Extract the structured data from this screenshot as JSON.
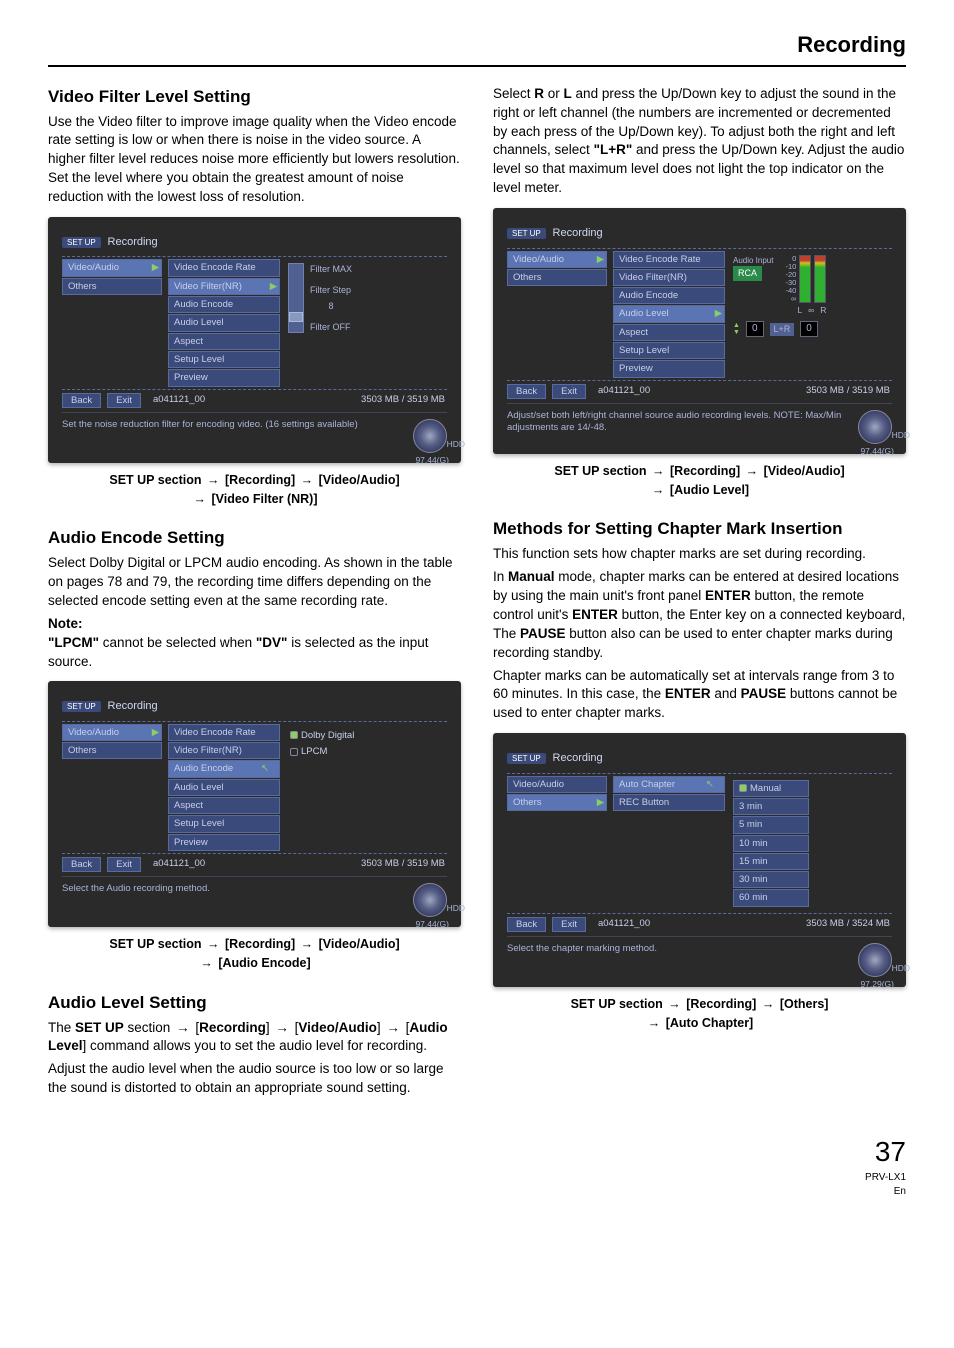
{
  "page_header": "Recording",
  "page_number": "37",
  "model": "PRV-LX1",
  "lang": "En",
  "arrow_glyph": "→",
  "left": {
    "video_filter": {
      "heading": "Video Filter Level Setting",
      "body": "Use the Video filter to improve image quality when the Video encode rate setting is low or when there is noise in the video source. A higher filter level reduces noise more efficiently but lowers resolution. Set the level where you obtain the greatest amount of noise reduction with the lowest loss of resolution.",
      "breadcrumb": [
        "SET UP section",
        "[Recording]",
        "[Video/Audio]",
        "[Video Filter (NR)]"
      ]
    },
    "audio_encode": {
      "heading": "Audio Encode Setting",
      "body": "Select Dolby Digital or LPCM audio encoding. As shown in the table on pages 78 and 79, the recording time differs depending on the selected encode setting even at the same recording rate.",
      "note_label": "Note:",
      "note_body_pre": "\"LPCM\"",
      "note_body_mid": " cannot be selected when ",
      "note_body_dv": "\"DV\"",
      "note_body_post": " is selected as the input source.",
      "breadcrumb": [
        "SET UP section",
        "[Recording]",
        "[Video/Audio]",
        "[Audio Encode]"
      ]
    },
    "audio_level": {
      "heading": "Audio Level Setting",
      "body_pre": "The ",
      "setup": "SET UP",
      "body_mid1": " section ",
      "rec": "Recording",
      "body_mid2": "] ",
      "va": "Video/Audio",
      "body_mid3": "] ",
      "al": "Audio Level",
      "body_post": "] command allows you to set the audio level for recording.",
      "body2": "Adjust the audio level when the audio source is too low or so large the sound is distorted to obtain an appropriate sound setting."
    }
  },
  "right": {
    "audio_level_cont": {
      "body_pre": "Select ",
      "r": "R",
      "body_mid1": " or ",
      "l": "L",
      "body_mid2": " and press the Up/Down key to adjust the sound in the right or left channel (the numbers are incremented or decremented by each press of the Up/Down key). To adjust both the right and left channels, select ",
      "lr": "\"L+R\"",
      "body_mid3": " and press the Up/Down key. Adjust the audio level so that maximum level does not light the top indicator on the level meter.",
      "breadcrumb": [
        "SET UP section",
        "[Recording]",
        "[Video/Audio]",
        "[Audio Level]"
      ]
    },
    "chapter": {
      "heading": "Methods for Setting Chapter Mark Insertion",
      "body1": "This function sets how chapter marks are set during recording.",
      "body2_pre": "In ",
      "manual": "Manual",
      "body2_mid1": " mode, chapter marks can be entered at desired locations by using the main unit's front panel ",
      "enter": "ENTER",
      "body2_mid2": " button, the remote control unit's ",
      "body2_mid3": " button, the Enter key on a connected keyboard, The ",
      "pause": "PAUSE",
      "body2_mid4": " button also can be used to enter chapter marks during recording standby.",
      "body3_pre": "Chapter marks can be automatically set at intervals range from 3 to 60 minutes. In this case, the ",
      "body3_mid": " and ",
      "body3_post": " buttons cannot be used to enter chapter marks.",
      "breadcrumb": [
        "SET UP section",
        "[Recording]",
        "[Others]",
        "[Auto Chapter]"
      ]
    }
  },
  "shots": {
    "common": {
      "setup_badge": "SET UP",
      "title": "Recording",
      "left_items": [
        "Video/Audio",
        "Others"
      ],
      "back": "Back",
      "exit": "Exit",
      "filename": "a041121_00",
      "capacity": "3503 MB / 3519 MB",
      "hdd": "HDD",
      "gb": "97.44(G)"
    },
    "filter": {
      "mid_items": [
        "Video Encode Rate",
        "Video Filter(NR)",
        "Audio Encode",
        "Audio Level",
        "Aspect",
        "Setup Level",
        "Preview"
      ],
      "max": "Filter MAX",
      "step": "Filter Step",
      "val": "8",
      "off": "Filter OFF",
      "help": "Set the noise reduction filter for encoding video.\n(16 settings available)"
    },
    "encode": {
      "mid_items": [
        "Video Encode Rate",
        "Video Filter(NR)",
        "Audio Encode",
        "Audio Level",
        "Aspect",
        "Setup Level",
        "Preview"
      ],
      "opts": [
        "Dolby Digital",
        "LPCM"
      ],
      "help": "Select the Audio recording method."
    },
    "level": {
      "mid_items": [
        "Video Encode Rate",
        "Video Filter(NR)",
        "Audio Encode",
        "Audio Level",
        "Aspect",
        "Setup Level",
        "Preview"
      ],
      "scale": [
        "0",
        "-10",
        "-20",
        "-30",
        "-40",
        "∞"
      ],
      "audio_input": "Audio Input",
      "rca": "RCA",
      "L": "L",
      "R": "R",
      "LR": "L+R",
      "val_l": "0",
      "val_r": "0",
      "help": "Adjust/set both left/right channel source audio recording levels.\nNOTE: Max/Min adjustments are 14/-48."
    },
    "chapter": {
      "left_items": [
        "Video/Audio",
        "Others"
      ],
      "mid_items": [
        "Auto Chapter",
        "REC Button"
      ],
      "opts": [
        "Manual",
        "3 min",
        "5 min",
        "10 min",
        "15 min",
        "30 min",
        "60 min"
      ],
      "capacity": "3503 MB / 3524 MB",
      "gb": "97.29(G)",
      "help": "Select the chapter marking method."
    }
  }
}
